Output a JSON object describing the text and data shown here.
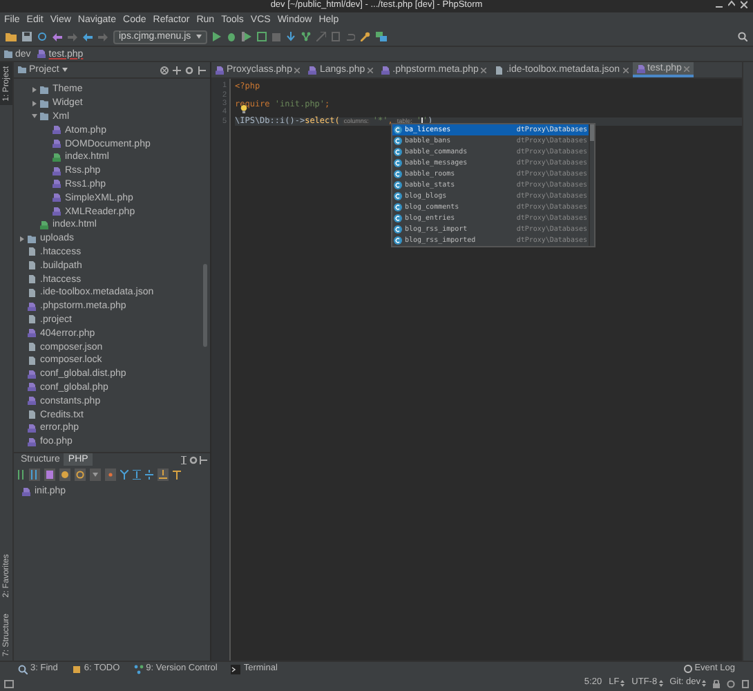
{
  "window": {
    "title": "dev [~/public_html/dev] - .../test.php [dev] - PhpStorm"
  },
  "menu": [
    "File",
    "Edit",
    "View",
    "Navigate",
    "Code",
    "Refactor",
    "Run",
    "Tools",
    "VCS",
    "Window",
    "Help"
  ],
  "toolbar": {
    "run_config": "ips.cjmg.menu.js"
  },
  "breadcrumbs": [
    {
      "label": "dev",
      "kind": "folder"
    },
    {
      "label": "test.php",
      "kind": "php"
    }
  ],
  "left_strip": {
    "top": "1: Project",
    "bottom": [
      "2: Favorites",
      "7: Structure"
    ]
  },
  "project_panel": {
    "title": "Project",
    "nested_items": [
      {
        "label": "Theme",
        "kind": "folder",
        "expanded": false
      },
      {
        "label": "Widget",
        "kind": "folder",
        "expanded": false
      },
      {
        "label": "Xml",
        "kind": "folder",
        "expanded": true,
        "children": [
          {
            "label": "Atom.php",
            "kind": "php"
          },
          {
            "label": "DOMDocument.php",
            "kind": "php"
          },
          {
            "label": "index.html",
            "kind": "html"
          },
          {
            "label": "Rss.php",
            "kind": "php"
          },
          {
            "label": "Rss1.php",
            "kind": "php"
          },
          {
            "label": "SimpleXML.php",
            "kind": "php"
          },
          {
            "label": "XMLReader.php",
            "kind": "php"
          }
        ]
      },
      {
        "label": "index.html",
        "kind": "html"
      }
    ],
    "items": [
      {
        "label": "uploads",
        "kind": "folder",
        "expanded": false
      },
      {
        "label": ".htaccess",
        "kind": "file"
      },
      {
        "label": ".buildpath",
        "kind": "file"
      },
      {
        "label": ".htaccess",
        "kind": "file"
      },
      {
        "label": ".ide-toolbox.metadata.json",
        "kind": "file"
      },
      {
        "label": ".phpstorm.meta.php",
        "kind": "php"
      },
      {
        "label": ".project",
        "kind": "file"
      },
      {
        "label": "404error.php",
        "kind": "php"
      },
      {
        "label": "composer.json",
        "kind": "file"
      },
      {
        "label": "composer.lock",
        "kind": "file"
      },
      {
        "label": "conf_global.dist.php",
        "kind": "php"
      },
      {
        "label": "conf_global.php",
        "kind": "php"
      },
      {
        "label": "constants.php",
        "kind": "php"
      },
      {
        "label": "Credits.txt",
        "kind": "file"
      },
      {
        "label": "error.php",
        "kind": "php"
      },
      {
        "label": "foo.php",
        "kind": "php"
      }
    ]
  },
  "structure_panel": {
    "tabs": [
      {
        "label": "Structure",
        "selected": false
      },
      {
        "label": "PHP",
        "selected": true
      }
    ],
    "items": [
      {
        "label": "init.php"
      }
    ]
  },
  "editor": {
    "tabs": [
      {
        "label": "Proxyclass.php",
        "selected": false
      },
      {
        "label": "Langs.php",
        "selected": false
      },
      {
        "label": ".phpstorm.meta.php",
        "selected": false
      },
      {
        "label": ".ide-toolbox.metadata.json",
        "selected": false
      },
      {
        "label": "test.php",
        "selected": true
      }
    ],
    "lines": [
      {
        "number": "1",
        "current": false,
        "tokens": [
          {
            "kind": "keyword",
            "text": "<?php"
          }
        ]
      },
      {
        "number": "2",
        "current": false
      },
      {
        "number": "3",
        "current": false,
        "tokens": [
          {
            "kind": "keyword",
            "text": "require"
          },
          {
            "kind": "string",
            "text": " 'init.php'"
          },
          {
            "kind": "keyword",
            "text": ";"
          }
        ]
      },
      {
        "number": "4",
        "current": false
      },
      {
        "number": "5",
        "current": true,
        "tokens": [
          {
            "kind": "plain",
            "text": "\\IPS\\Db::i()->"
          },
          {
            "kind": "method",
            "text": "select("
          },
          {
            "kind": "hint",
            "text": "columns:"
          },
          {
            "kind": "string",
            "text": "'*'"
          },
          {
            "kind": "keyword",
            "text": ","
          },
          {
            "kind": "hint",
            "text": "table:"
          },
          {
            "kind": "string",
            "text": "'"
          },
          {
            "kind": "caret"
          },
          {
            "kind": "string",
            "text": "'"
          },
          {
            "kind": "plain",
            "text": ")"
          }
        ]
      }
    ],
    "completion": [
      {
        "name": "ba_licenses",
        "type": "dtProxy\\Databases",
        "selected": true
      },
      {
        "name": "babble_bans",
        "type": "dtProxy\\Databases",
        "selected": false
      },
      {
        "name": "babble_commands",
        "type": "dtProxy\\Databases",
        "selected": false
      },
      {
        "name": "babble_messages",
        "type": "dtProxy\\Databases",
        "selected": false
      },
      {
        "name": "babble_rooms",
        "type": "dtProxy\\Databases",
        "selected": false
      },
      {
        "name": "babble_stats",
        "type": "dtProxy\\Databases",
        "selected": false
      },
      {
        "name": "blog_blogs",
        "type": "dtProxy\\Databases",
        "selected": false
      },
      {
        "name": "blog_comments",
        "type": "dtProxy\\Databases",
        "selected": false
      },
      {
        "name": "blog_entries",
        "type": "dtProxy\\Databases",
        "selected": false
      },
      {
        "name": "blog_rss_import",
        "type": "dtProxy\\Databases",
        "selected": false
      },
      {
        "name": "blog_rss_imported",
        "type": "dtProxy\\Databases",
        "selected": false
      }
    ]
  },
  "tool_windows": [
    {
      "label": "3: Find",
      "kind": "find"
    },
    {
      "label": "6: TODO",
      "kind": "todo"
    },
    {
      "label": "9: Version Control",
      "kind": "vcs"
    },
    {
      "label": "Terminal",
      "kind": "terminal"
    }
  ],
  "event_log": "Event Log",
  "status_bar": {
    "position": "5:20",
    "line_sep": "LF",
    "encoding": "UTF-8",
    "vcs": "Git: dev"
  }
}
